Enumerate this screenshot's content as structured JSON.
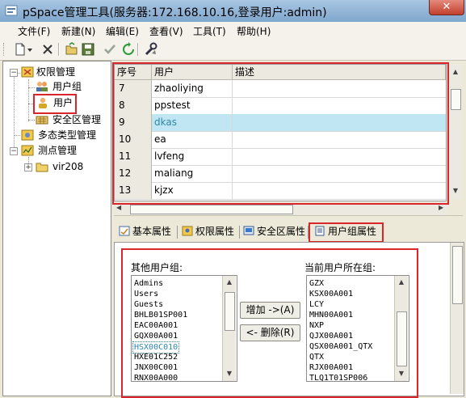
{
  "window": {
    "title": "pSpace管理工具(服务器:172.168.10.16,登录用户:admin)",
    "close_label": "✕"
  },
  "menubar": {
    "items": [
      "文件(F)",
      "新建(N)",
      "编辑(E)",
      "查看(V)",
      "工具(T)",
      "帮助(H)"
    ]
  },
  "toolbar": {
    "icons": [
      "new-document-icon",
      "dropdown-arrow-icon",
      "delete-x-icon",
      "open-folder-icon",
      "save-icon",
      "check-icon",
      "refresh-icon",
      "tools-icon"
    ]
  },
  "tree": {
    "root": "权限管理",
    "children": [
      "用户组",
      "用户",
      "安全区管理"
    ],
    "polytype": "多态类型管理",
    "points": "测点管理",
    "points_child": "vir208",
    "collapse_glyph": "−",
    "expand_glyph": "+"
  },
  "grid": {
    "columns": [
      "序号",
      "用户",
      "描述"
    ],
    "rows": [
      {
        "id": "7",
        "user": "zhaoliying",
        "desc": ""
      },
      {
        "id": "8",
        "user": "ppstest",
        "desc": ""
      },
      {
        "id": "9",
        "user": "dkas",
        "desc": "",
        "selected": true
      },
      {
        "id": "10",
        "user": "ea",
        "desc": ""
      },
      {
        "id": "11",
        "user": "lvfeng",
        "desc": ""
      },
      {
        "id": "12",
        "user": "maliang",
        "desc": ""
      },
      {
        "id": "13",
        "user": "kjzx",
        "desc": ""
      }
    ]
  },
  "tabs": [
    {
      "label": "基本属性",
      "icon": "basic-properties-icon"
    },
    {
      "label": "权限属性",
      "icon": "permission-properties-icon"
    },
    {
      "label": "安全区属性",
      "icon": "security-zone-icon"
    },
    {
      "label": "用户组属性",
      "icon": "usergroup-properties-icon",
      "active": true
    }
  ],
  "group_panel": {
    "other_label": "其他用户组:",
    "current_label": "当前用户所在组:",
    "add_button": "增加 ->(A)",
    "remove_button": "<- 删除(R)",
    "other_groups": [
      "Admins",
      "Users",
      "Guests",
      "BHLB01SP001",
      "EAC00A001",
      "GQX00A001",
      "HSX00C010",
      "HXE01C252",
      "JNX00C001",
      "RNX00A000"
    ],
    "other_selected": "HSX00C010",
    "current_groups": [
      "GZX",
      "KSX00A001",
      "LCY",
      "MHN00A001",
      "NXP",
      "QJX00A001",
      "QSX00A001_QTX",
      "QTX",
      "RJX00A001",
      "TLQ1T01SP006"
    ]
  },
  "colors": {
    "highlight_box": "#d9262c",
    "selected_row": "#bfe6f2",
    "selected_text": "#2f87a8"
  }
}
